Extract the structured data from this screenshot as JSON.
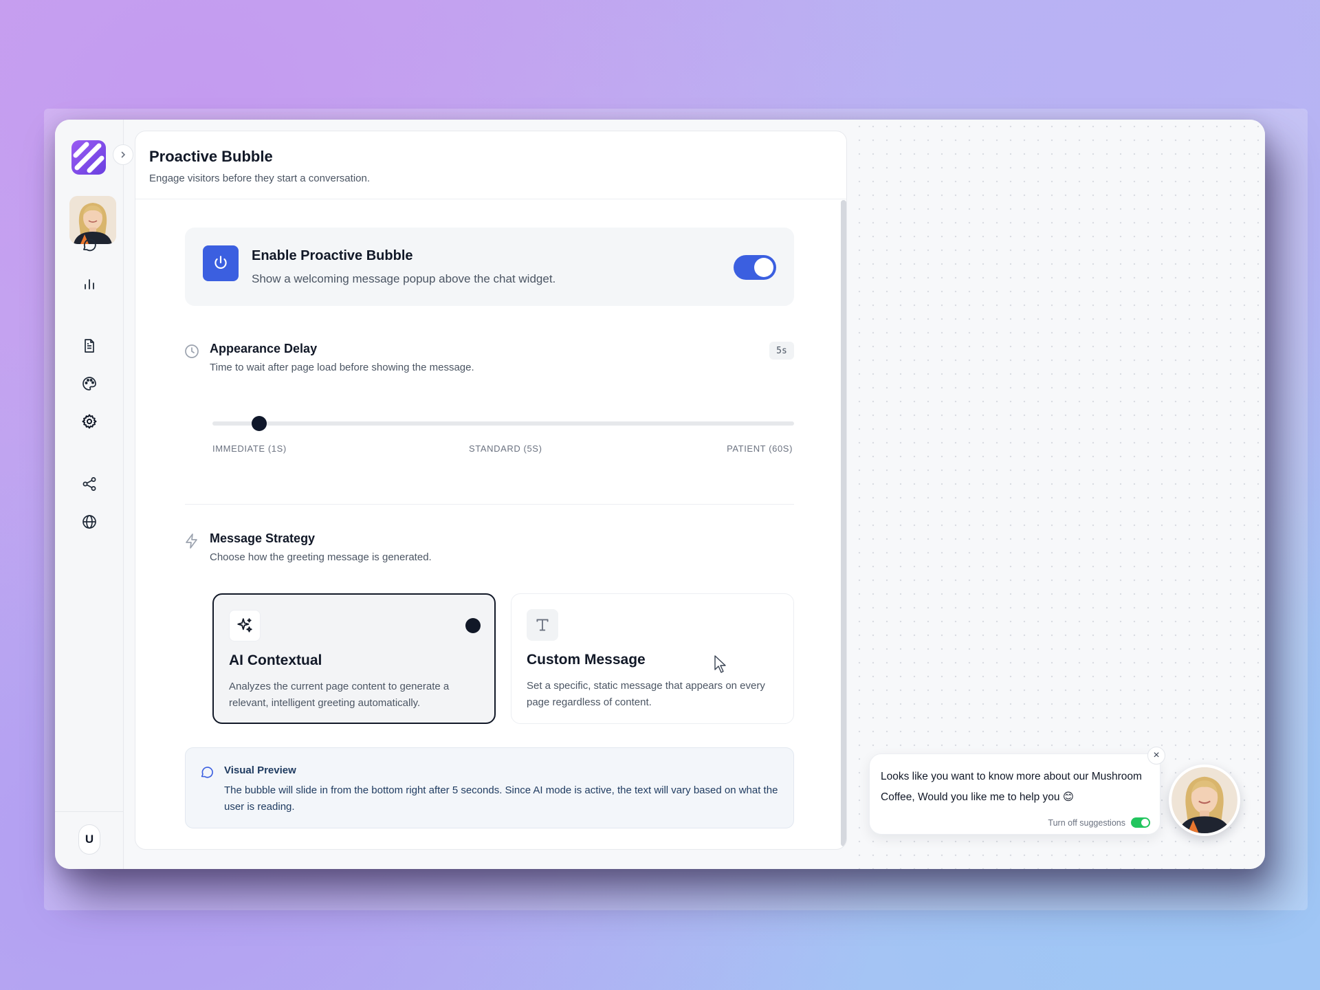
{
  "sidebar": {
    "logo": "brand-logo",
    "expand_icon": "chevron-right-icon",
    "nav_icons": [
      "chat-icon",
      "bar-chart-icon",
      "document-icon",
      "palette-icon",
      "gear-icon",
      "share-icon",
      "globe-icon"
    ],
    "active_item": "gear-icon",
    "user_initial": "U"
  },
  "header": {
    "title": "Proactive Bubble",
    "subtitle": "Engage visitors before they start a conversation."
  },
  "enable": {
    "title": "Enable Proactive Bubble",
    "description": "Show a welcoming message popup above the chat widget.",
    "enabled": true,
    "accent": "#3b5fe0"
  },
  "delay": {
    "title": "Appearance Delay",
    "description": "Time to wait after page load before showing the message.",
    "badge": "5s",
    "value_seconds": 5,
    "min_seconds": 1,
    "max_seconds": 60,
    "labels": {
      "min": "IMMEDIATE (1S)",
      "mid": "STANDARD (5S)",
      "max": "PATIENT (60S)"
    }
  },
  "strategy": {
    "title": "Message Strategy",
    "description": "Choose how the greeting message is generated.",
    "selected": "ai",
    "options": [
      {
        "id": "ai",
        "icon": "sparkles-icon",
        "title": "AI Contextual",
        "description": "Analyzes the current page content to generate a relevant, intelligent greeting automatically."
      },
      {
        "id": "custom",
        "icon": "text-t-icon",
        "title": "Custom Message",
        "description": "Set a specific, static message that appears on every page regardless of content."
      }
    ]
  },
  "preview": {
    "title": "Visual Preview",
    "text": "The bubble will slide in from the bottom right after 5 seconds. Since AI mode is active, the text will vary based on what the user is reading."
  },
  "bubble": {
    "message": "Looks like you want to know more about our Mushroom Coffee, Would you like me to help you 😊",
    "footer_label": "Turn off suggestions",
    "suggestions_on": true,
    "close_label": "×"
  }
}
